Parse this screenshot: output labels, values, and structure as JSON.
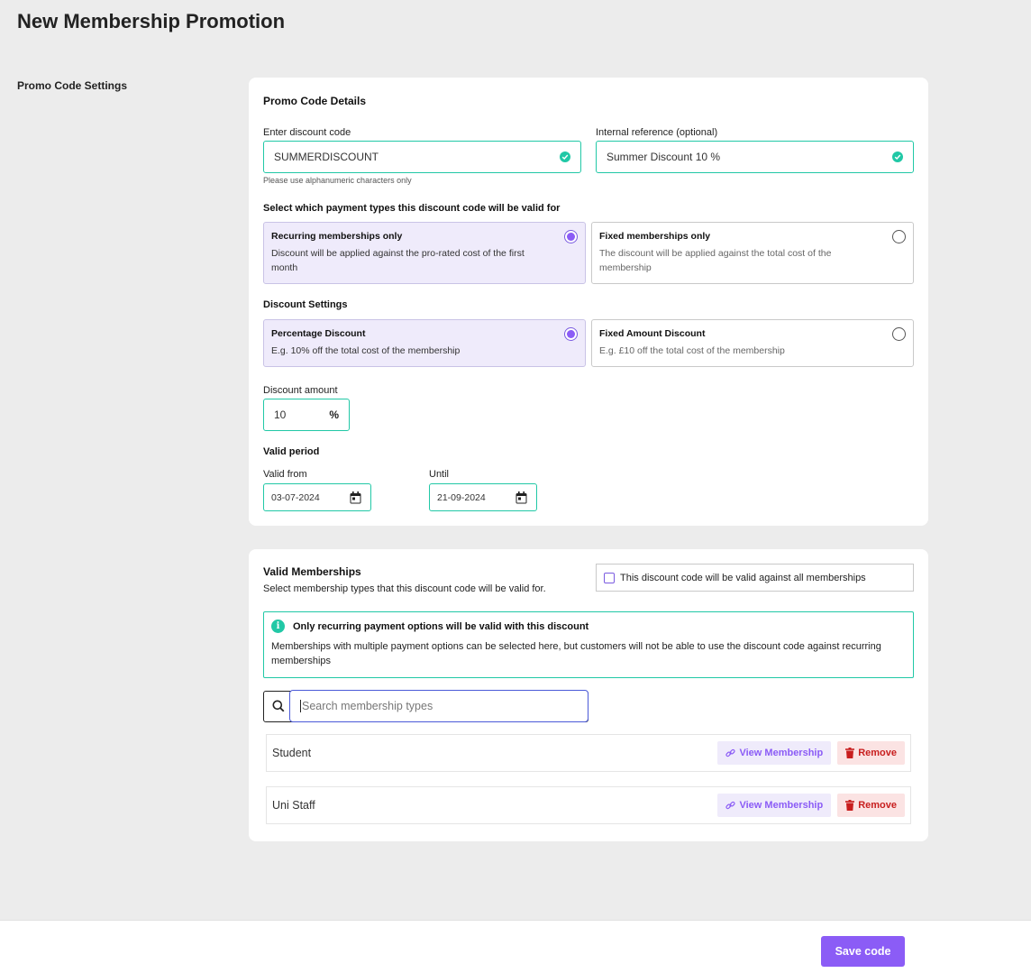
{
  "page": {
    "title": "New Membership Promotion",
    "section_label": "Promo Code Settings"
  },
  "promo": {
    "card_title": "Promo Code Details",
    "code_label": "Enter discount code",
    "code_value": "SUMMERDISCOUNT",
    "code_hint": "Please use alphanumeric characters only",
    "ref_label": "Internal reference (optional)",
    "ref_value": "Summer Discount 10 %"
  },
  "payment_types": {
    "heading": "Select which payment types this discount code will be valid for",
    "options": [
      {
        "title": "Recurring memberships only",
        "desc": "Discount will be applied against the pro-rated cost of the first month",
        "selected": true
      },
      {
        "title": "Fixed memberships only",
        "desc": "The discount will be applied against the total cost of the membership",
        "selected": false
      }
    ]
  },
  "discount_settings": {
    "heading": "Discount Settings",
    "options": [
      {
        "title": "Percentage Discount",
        "desc": "E.g. 10% off the total cost of the membership",
        "selected": true
      },
      {
        "title": "Fixed Amount Discount",
        "desc": "E.g. £10 off the total cost of the membership",
        "selected": false
      }
    ],
    "amount_label": "Discount amount",
    "amount_value": "10",
    "amount_unit": "%"
  },
  "valid_period": {
    "heading": "Valid period",
    "from_label": "Valid from",
    "from_value": "03-07-2024",
    "until_label": "Until",
    "until_value": "21-09-2024"
  },
  "valid_memberships": {
    "card_title": "Valid Memberships",
    "subtitle": "Select membership types that this discount code will be valid for.",
    "all_label": "This discount code will be valid against all memberships",
    "all_checked": false,
    "info_title": "Only recurring payment options will be valid with this discount",
    "info_body": "Memberships with multiple payment options can be selected here, but customers will not be able to use the discount code against recurring memberships",
    "search_placeholder": "Search membership types",
    "items": [
      {
        "name": "Student",
        "view_label": "View Membership",
        "remove_label": "Remove"
      },
      {
        "name": "Uni Staff",
        "view_label": "View Membership",
        "remove_label": "Remove"
      }
    ]
  },
  "footer": {
    "save_label": "Save code"
  },
  "colors": {
    "accent": "#8b5cf6",
    "success": "#21c8a6",
    "danger": "#c81e1e",
    "background": "#ececec"
  }
}
